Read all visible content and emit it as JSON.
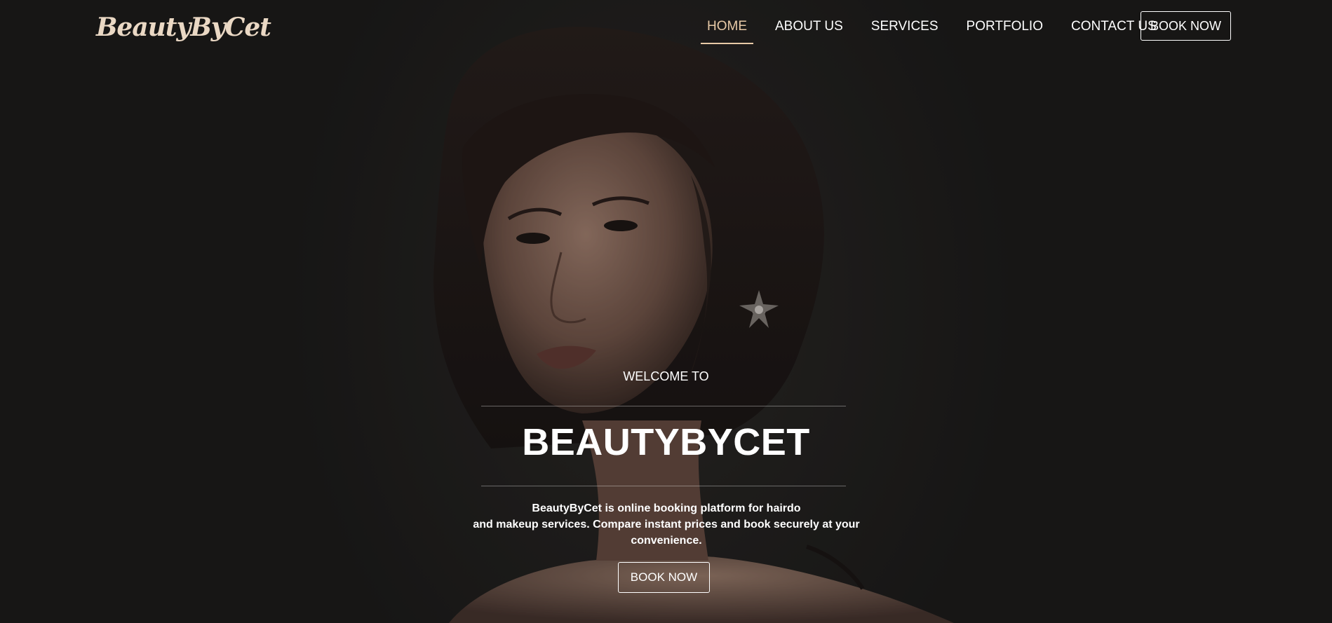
{
  "brand": {
    "logo_text": "BeautyByCet",
    "logo_color": "#ead8c4",
    "accent_color": "#e7c9a6"
  },
  "nav": {
    "items": [
      {
        "label": "HOME",
        "active": true
      },
      {
        "label": "ABOUT US",
        "active": false
      },
      {
        "label": "SERVICES",
        "active": false
      },
      {
        "label": "PORTFOLIO",
        "active": false
      },
      {
        "label": "CONTACT US",
        "active": false
      }
    ],
    "book_label": "BOOK NOW"
  },
  "hero": {
    "welcome": "WELCOME TO",
    "title": "BEAUTYBYCET",
    "description_lines": [
      "BeautyByCet is online booking platform for hairdo",
      "and makeup services. Compare instant prices and book securely at your",
      "convenience."
    ],
    "book_label": "BOOK NOW",
    "background": "portrait-photo"
  }
}
